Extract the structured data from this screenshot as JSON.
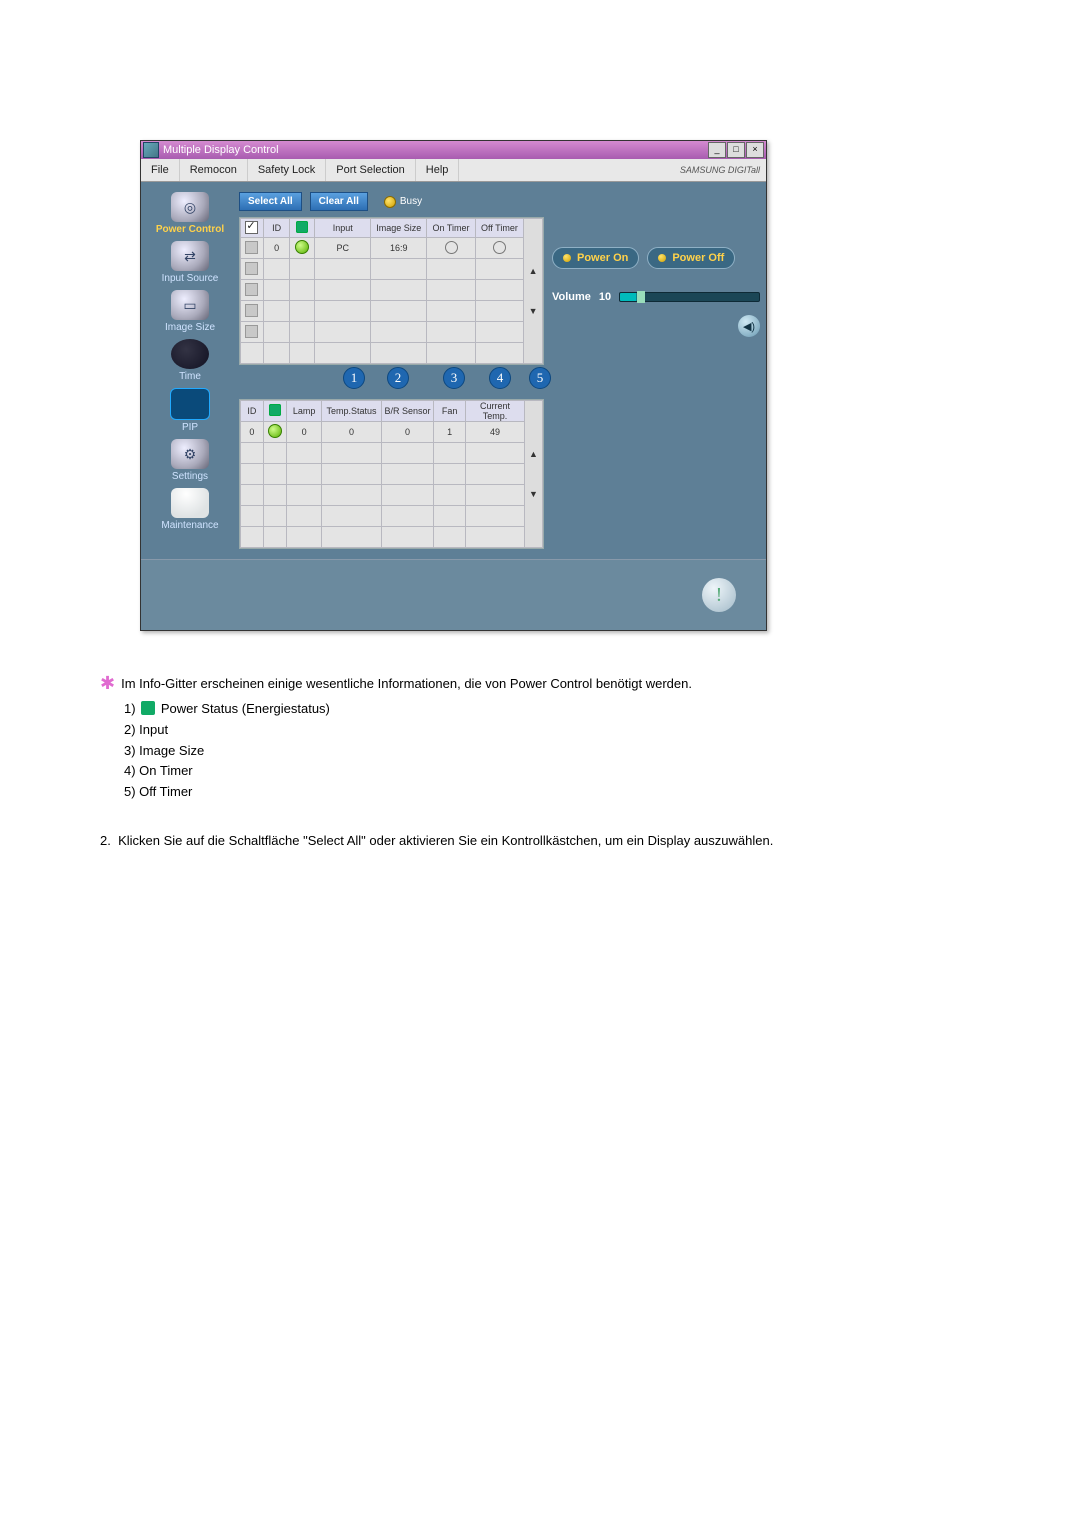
{
  "window": {
    "title": "Multiple Display Control",
    "menu": {
      "file": "File",
      "remocon": "Remocon",
      "safety_lock": "Safety Lock",
      "port_selection": "Port Selection",
      "help": "Help"
    },
    "brand": "SAMSUNG DIGITall"
  },
  "toolbar": {
    "select_all": "Select All",
    "clear_all": "Clear All",
    "busy": "Busy"
  },
  "sidebar": {
    "power_control": "Power Control",
    "input_source": "Input Source",
    "image_size": "Image Size",
    "time": "Time",
    "pip": "PIP",
    "settings": "Settings",
    "maintenance": "Maintenance"
  },
  "grid1": {
    "headers": {
      "id": "ID",
      "input": "Input",
      "image_size": "Image Size",
      "on_timer": "On Timer",
      "off_timer": "Off Timer"
    },
    "row": {
      "id": "0",
      "input": "PC",
      "image_size": "16:9"
    }
  },
  "grid2": {
    "headers": {
      "id": "ID",
      "lamp": "Lamp",
      "temp_status": "Temp.Status",
      "br_sensor": "B/R Sensor",
      "fan": "Fan",
      "current_temp": "Current Temp."
    },
    "row": {
      "id": "0",
      "lamp": "0",
      "temp_status": "0",
      "br_sensor": "0",
      "fan": "1",
      "current_temp": "49"
    }
  },
  "right": {
    "power_on": "Power On",
    "power_off": "Power Off",
    "volume_label": "Volume",
    "volume_value": "10"
  },
  "callouts": {
    "n1": "1",
    "n2": "2",
    "n3": "3",
    "n4": "4",
    "n5": "5"
  },
  "doc": {
    "intro": "Im Info-Gitter erscheinen einige wesentliche Informationen, die von Power Control benötigt werden.",
    "item1_pre": "1)",
    "item1_post": "Power Status (Energiestatus)",
    "item2": "2) Input",
    "item3": "3) Image Size",
    "item4": "4) On Timer",
    "item5": "5) Off Timer",
    "step2_num": "2.",
    "step2": "Klicken Sie auf die Schaltfläche \"Select All\" oder aktivieren Sie ein Kontrollkästchen, um ein Display auszuwählen."
  }
}
